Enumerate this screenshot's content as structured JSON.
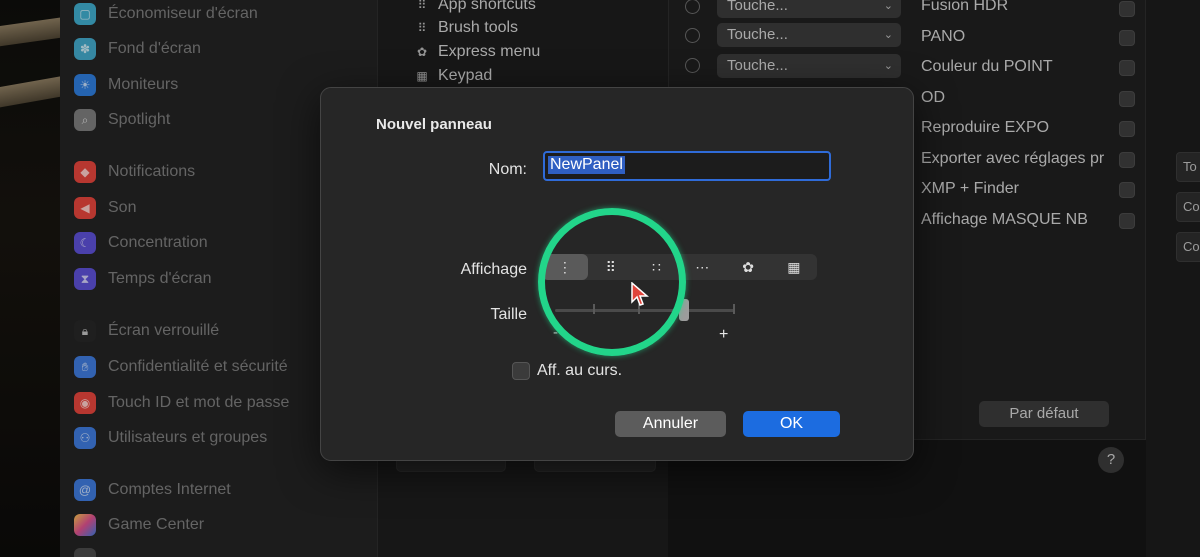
{
  "sidebar": {
    "items": [
      {
        "label": "Économiseur d'écran",
        "icon": "screensaver-icon",
        "color": "#3fa9c9"
      },
      {
        "label": "Fond d'écran",
        "icon": "wallpaper-icon",
        "color": "#41a5c6"
      },
      {
        "label": "Moniteurs",
        "icon": "displays-icon",
        "color": "#2e7ad8"
      },
      {
        "label": "Spotlight",
        "icon": "spotlight-icon",
        "color": "#7a7a7a"
      },
      {
        "label": "Notifications",
        "icon": "notifications-icon",
        "color": "#e0443b"
      },
      {
        "label": "Son",
        "icon": "sound-icon",
        "color": "#e0443b"
      },
      {
        "label": "Concentration",
        "icon": "focus-icon",
        "color": "#5b4fd1"
      },
      {
        "label": "Temps d'écran",
        "icon": "screen-time-icon",
        "color": "#5b4fd1"
      },
      {
        "label": "Écran verrouillé",
        "icon": "lock-screen-icon",
        "color": "#262626"
      },
      {
        "label": "Confidentialité et sécurité",
        "icon": "privacy-hand-icon",
        "color": "#3d78d8"
      },
      {
        "label": "Touch ID et mot de passe",
        "icon": "touch-id-icon",
        "color": "#e0443b"
      },
      {
        "label": "Utilisateurs et groupes",
        "icon": "users-icon",
        "color": "#3d78d8"
      },
      {
        "label": "Comptes Internet",
        "icon": "internet-accounts-icon",
        "color": "#3d78d8"
      },
      {
        "label": "Game Center",
        "icon": "game-center-icon",
        "color": "#d94f8c"
      }
    ]
  },
  "middle": {
    "items": [
      {
        "label": "App shortcuts",
        "icon": "grid-dots-icon"
      },
      {
        "label": "Brush tools",
        "icon": "grid-dots-icon"
      },
      {
        "label": "Express menu",
        "icon": "flower-icon"
      },
      {
        "label": "Keypad",
        "icon": "keypad-icon"
      }
    ]
  },
  "right": {
    "rows": [
      {
        "select": "Touche...",
        "label": "Fusion HDR"
      },
      {
        "select": "Touche...",
        "label": "PANO"
      },
      {
        "select": "Touche...",
        "label": "Couleur du POINT"
      },
      {
        "select": "",
        "label": "OD"
      },
      {
        "select": "",
        "label": "Reproduire EXPO"
      },
      {
        "select": "",
        "label": "Exporter avec réglages pr"
      },
      {
        "select": "",
        "label": "XMP + Finder"
      },
      {
        "select": "",
        "label": "Affichage MASQUE NB"
      }
    ],
    "default_button": "Par défaut",
    "help": "?"
  },
  "far_right": {
    "labels": [
      "To",
      "Co",
      "Co"
    ]
  },
  "dialog": {
    "title": "Nouvel panneau",
    "name_label": "Nom:",
    "name_value": "NewPanel",
    "display_label": "Affichage",
    "display_options": [
      "⋮",
      "⠿",
      "∷",
      "⋯",
      "✿",
      "▦"
    ],
    "display_selected": 0,
    "size_label": "Taille",
    "size_minus": "-",
    "size_plus": "+",
    "size_level_fraction": 0.7,
    "cursor_checkbox_label": "Aff. au curs.",
    "cancel_label": "Annuler",
    "ok_label": "OK"
  },
  "colors": {
    "accent": "#1c6ce0",
    "highlight_ring": "#22d58a",
    "cursor": "#e0443b"
  }
}
